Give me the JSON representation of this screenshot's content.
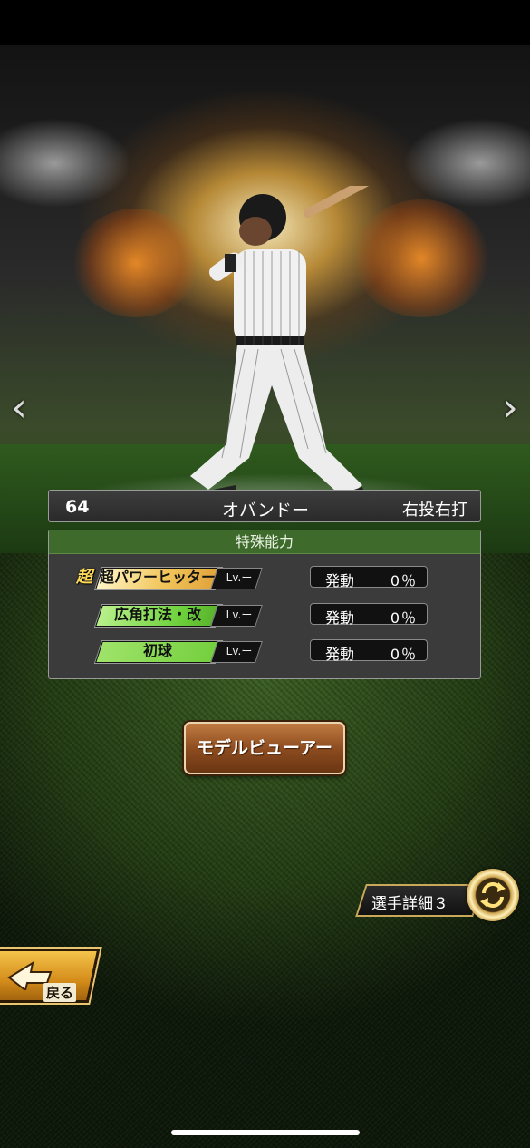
{
  "player": {
    "number": "64",
    "name": "オバンドー",
    "throw_bat": "右投右打"
  },
  "abilities": {
    "header": "特殊能力",
    "items": [
      {
        "super_mark": "超",
        "name": "超パワーヒッター",
        "lv": "Lv.ー",
        "rate_label": "発動",
        "rate": "0％",
        "tier": "gold"
      },
      {
        "name": "広角打法・改",
        "lv": "Lv.ー",
        "rate_label": "発動",
        "rate": "0％",
        "tier": "green"
      },
      {
        "name": "初球",
        "lv": "Lv.ー",
        "rate_label": "発動",
        "rate": "0％",
        "tier": "lime"
      }
    ]
  },
  "buttons": {
    "model_viewer": "モデルビューアー",
    "detail": "選手詳細３",
    "back": "戻る"
  },
  "nav": {
    "prev": "‹",
    "next": "›"
  },
  "colors": {
    "panel_header": "#3e6a2c",
    "button_brown": "#8a4a1e",
    "gold_accent": "#c9a85a"
  }
}
